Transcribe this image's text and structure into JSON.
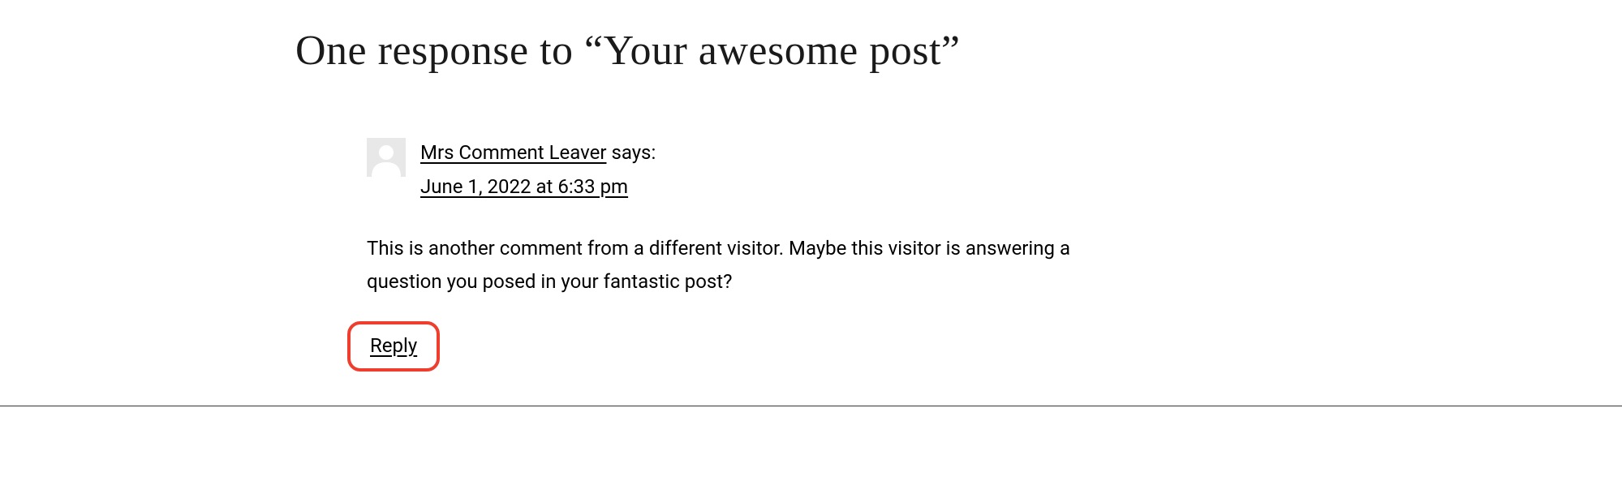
{
  "title": "One response to “Your awesome post”",
  "comment": {
    "author": "Mrs Comment Leaver",
    "says": " says:",
    "timestamp": "June 1, 2022 at 6:33 pm",
    "body": "This is another comment from a different visitor. Maybe this visitor is answering a question you posed in your fantastic post?",
    "reply": "Reply"
  }
}
